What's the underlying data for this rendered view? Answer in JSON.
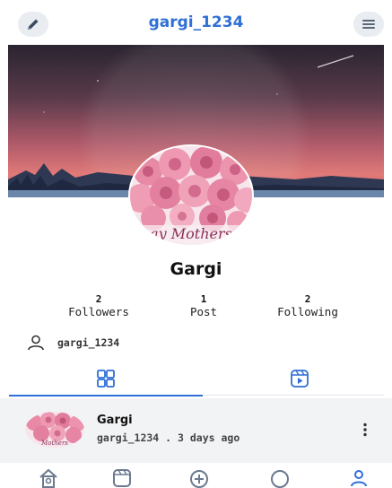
{
  "header": {
    "title": "gargi_1234",
    "edit_icon": "pencil-icon",
    "menu_icon": "menu-icon"
  },
  "profile": {
    "avatar_caption": "ay Mothers",
    "name": "Gargi",
    "stats": [
      {
        "count": "2",
        "label": "Followers"
      },
      {
        "count": "1",
        "label": "Post"
      },
      {
        "count": "2",
        "label": "Following"
      }
    ],
    "username": "gargi_1234"
  },
  "tabs": [
    {
      "icon": "grid-icon",
      "active": true
    },
    {
      "icon": "reels-icon",
      "active": false
    }
  ],
  "post": {
    "author": "Gargi",
    "meta": "gargi_1234 . 3 days ago",
    "thumb_caption": "Mothers"
  },
  "bottom_nav": [
    {
      "icon": "home-icon"
    },
    {
      "icon": "reels-icon"
    },
    {
      "icon": "add-icon"
    },
    {
      "icon": "chat-icon"
    },
    {
      "icon": "profile-icon"
    }
  ],
  "colors": {
    "accent": "#2f6fd6",
    "icon_gray": "#6b7a90",
    "background": "#ffffff"
  }
}
